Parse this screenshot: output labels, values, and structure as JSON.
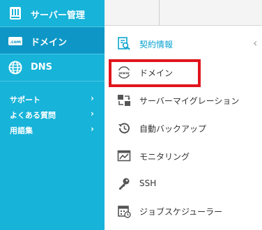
{
  "sidebar": {
    "items": [
      {
        "label": "サーバー管理",
        "icon": "server-icon"
      },
      {
        "label": "ドメイン",
        "icon": "com-tag-icon"
      },
      {
        "label": "DNS",
        "icon": "globe-icon"
      }
    ],
    "links": [
      {
        "label": "サポート",
        "chevron": "›"
      },
      {
        "label": "よくある質問",
        "chevron": "›"
      },
      {
        "label": "用語集",
        "chevron": "›"
      }
    ]
  },
  "collapse_chevron": "‹",
  "menu": {
    "items": [
      {
        "label": "契約情報",
        "icon": "contract-search-icon"
      },
      {
        "label": "ドメイン",
        "icon": "www-globe-icon"
      },
      {
        "label": "サーバーマイグレーション",
        "icon": "migration-icon"
      },
      {
        "label": "自動バックアップ",
        "icon": "backup-clock-icon"
      },
      {
        "label": "モニタリング",
        "icon": "monitor-chart-icon"
      },
      {
        "label": "SSH",
        "icon": "key-icon"
      },
      {
        "label": "ジョブスケジューラー",
        "icon": "calendar-icon"
      }
    ]
  },
  "colors": {
    "sidebar_bg": "#17b3d9",
    "sidebar_active": "#0e97c6",
    "accent_text": "#0aa3cf",
    "highlight_border": "#e1141c"
  }
}
